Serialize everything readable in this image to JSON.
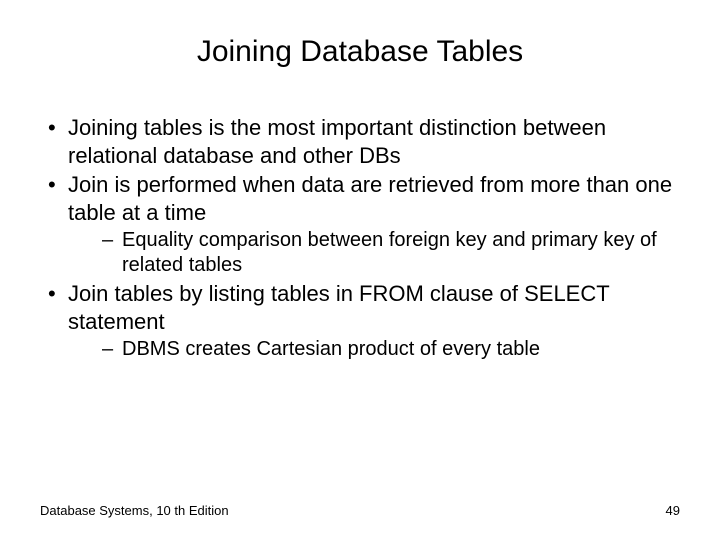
{
  "title": "Joining Database Tables",
  "bullets": [
    {
      "text": "Joining tables is the most important distinction between relational database and other DBs"
    },
    {
      "text": "Join is performed when data are retrieved from more than one table at a time",
      "sub": [
        "Equality comparison between foreign key and primary key of related tables"
      ]
    },
    {
      "text": "Join tables by listing tables in FROM clause of SELECT statement",
      "sub": [
        "DBMS creates Cartesian product of every table"
      ]
    }
  ],
  "footer": {
    "left": "Database Systems, 10 th Edition",
    "right": "49"
  }
}
